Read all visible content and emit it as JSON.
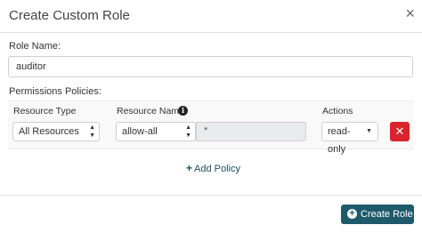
{
  "dialog": {
    "title": "Create Custom Role",
    "close_glyph": "×"
  },
  "role_name": {
    "label": "Role Name:",
    "value": "auditor"
  },
  "permissions": {
    "label": "Permissions Policies:",
    "columns": {
      "resource_type": "Resource Type",
      "resource_name": "Resource Name",
      "actions": "Actions"
    },
    "policy": {
      "resource_type": "All Resources",
      "resource_name": "allow-all",
      "resource_value": "*",
      "action": "read-only"
    },
    "delete_glyph": "✕",
    "add_policy_label": "Add Policy"
  },
  "footer": {
    "create_label": "Create Role"
  },
  "icons": {
    "close": "close-icon",
    "info": "info-icon",
    "delete": "delete-icon",
    "add": "plus-icon",
    "create": "plus-circle-icon"
  },
  "colors": {
    "primary": "#1f5a6b",
    "danger": "#d9232d"
  }
}
